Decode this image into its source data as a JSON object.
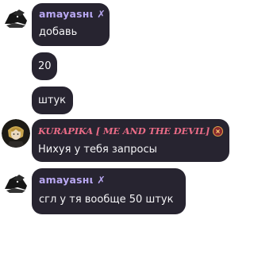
{
  "messages": [
    {
      "author": "amayasнι ✗",
      "text": "добавь"
    },
    {
      "text": "20"
    },
    {
      "text": "штук"
    },
    {
      "author": "KURAPIKA [ ME AND THE DEVIL]",
      "text": "Нихуя у тебя запросы"
    },
    {
      "author": "amayasнι ✗",
      "text": "сгл у тя вообще 50 штук"
    }
  ],
  "colors": {
    "bubble": "#272430",
    "amaya_name": "#b9a8f2",
    "kura_name": "#e96b86",
    "text": "#f4f4f6"
  },
  "icons": {
    "avatar_1": "dark-anime-character-avatar",
    "avatar_2": "kurapika-avatar",
    "badge": "emblem-badge-icon"
  }
}
